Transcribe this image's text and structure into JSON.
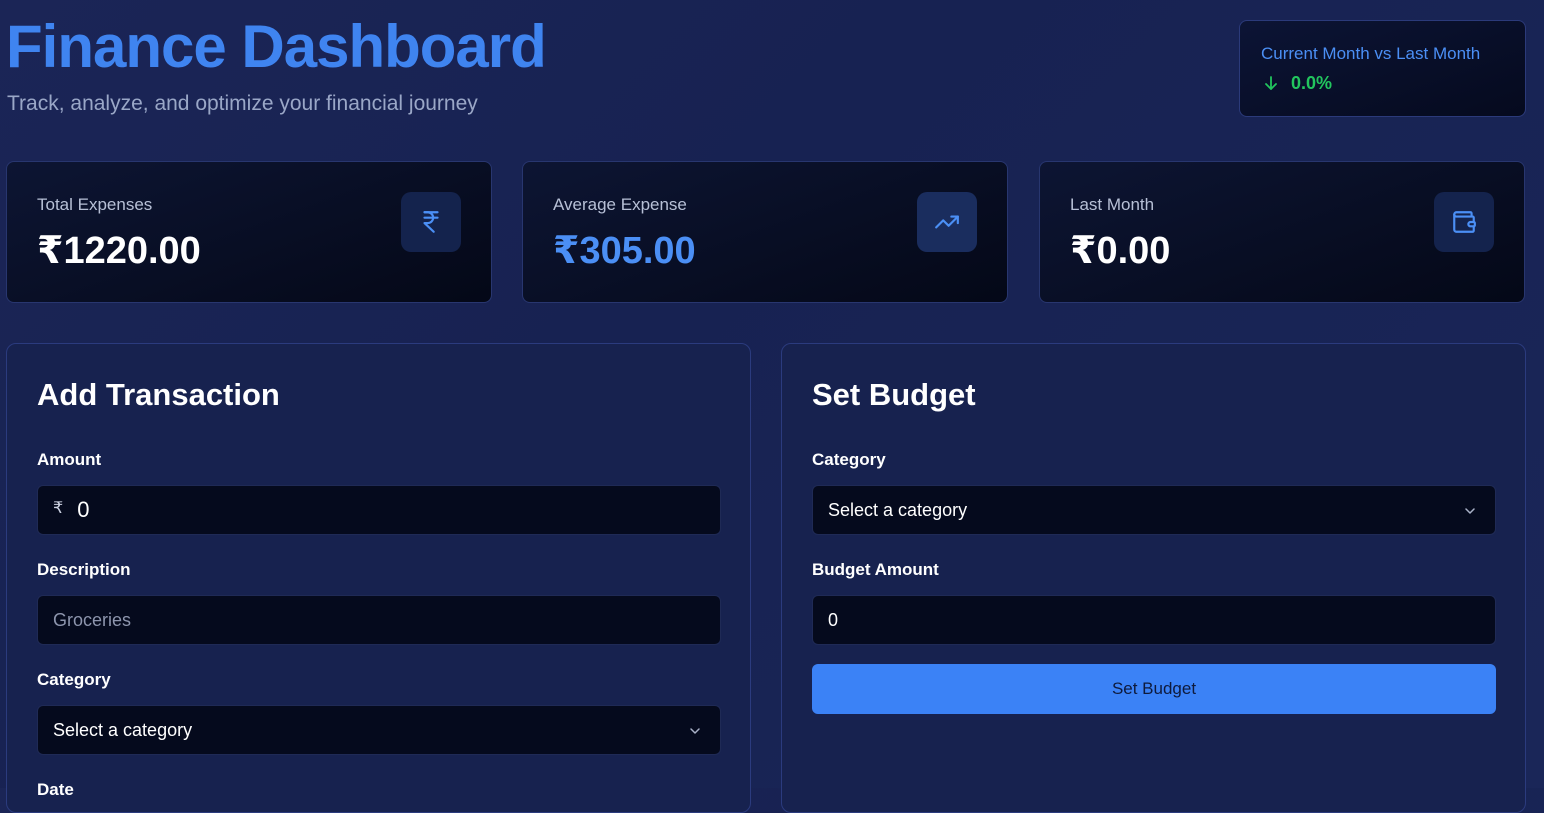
{
  "header": {
    "title": "Finance Dashboard",
    "subtitle": "Track, analyze, and optimize your financial journey"
  },
  "comparison": {
    "title": "Current Month vs Last Month",
    "direction_icon": "arrow-down-icon",
    "value": "0.0%",
    "color": "#22c55e"
  },
  "stats": [
    {
      "label": "Total Expenses",
      "value": "₹1220.00",
      "icon": "rupee-icon"
    },
    {
      "label": "Average Expense",
      "value": "₹305.00",
      "icon": "trending-up-icon"
    },
    {
      "label": "Last Month",
      "value": "₹0.00",
      "icon": "wallet-icon"
    }
  ],
  "add_transaction": {
    "title": "Add Transaction",
    "amount_label": "Amount",
    "amount_prefix": "₹",
    "amount_value": "0",
    "description_label": "Description",
    "description_placeholder": "Groceries",
    "category_label": "Category",
    "category_value": "Select a category",
    "date_label": "Date"
  },
  "set_budget": {
    "title": "Set Budget",
    "category_label": "Category",
    "category_value": "Select a category",
    "amount_label": "Budget Amount",
    "amount_value": "0",
    "button_label": "Set Budget"
  },
  "colors": {
    "accent": "#3b82f6",
    "title": "#3f84f0",
    "positive": "#22c55e",
    "background": "#172252"
  }
}
